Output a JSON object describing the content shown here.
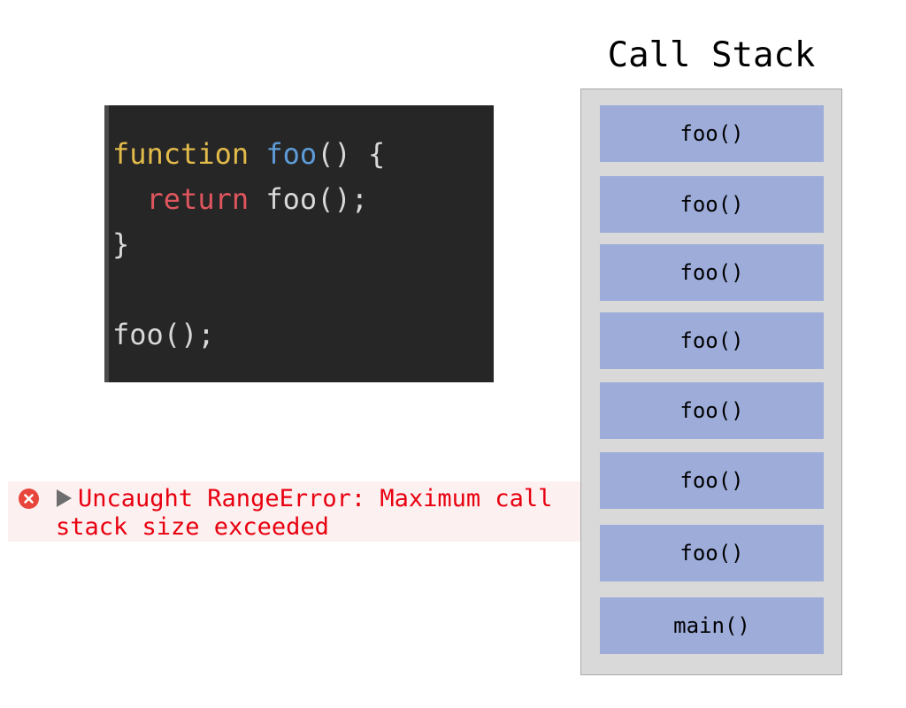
{
  "code": {
    "line1": {
      "keyword": "function",
      "name": "foo",
      "rest": "() {"
    },
    "line2": {
      "keyword": "return",
      "rest": "foo();"
    },
    "line3": {
      "text": "}"
    },
    "line5": {
      "text": "foo();"
    }
  },
  "error": {
    "icon": "error-x-icon",
    "expand_icon": "triangle-right-icon",
    "message": "Uncaught RangeError: Maximum call stack size exceeded"
  },
  "call_stack": {
    "title": "Call Stack",
    "frames": [
      "foo()",
      "foo()",
      "foo()",
      "foo()",
      "foo()",
      "foo()",
      "foo()",
      "main()"
    ]
  },
  "colors": {
    "code_bg": "#262626",
    "keyword": "#e3bb4a",
    "function_name": "#5e9cd9",
    "return_keyword": "#e0565e",
    "error_text": "#e8000f",
    "error_bg": "#fdf0f0",
    "frame_fill": "#9dacd9",
    "stack_bg": "#d9d9d9"
  }
}
